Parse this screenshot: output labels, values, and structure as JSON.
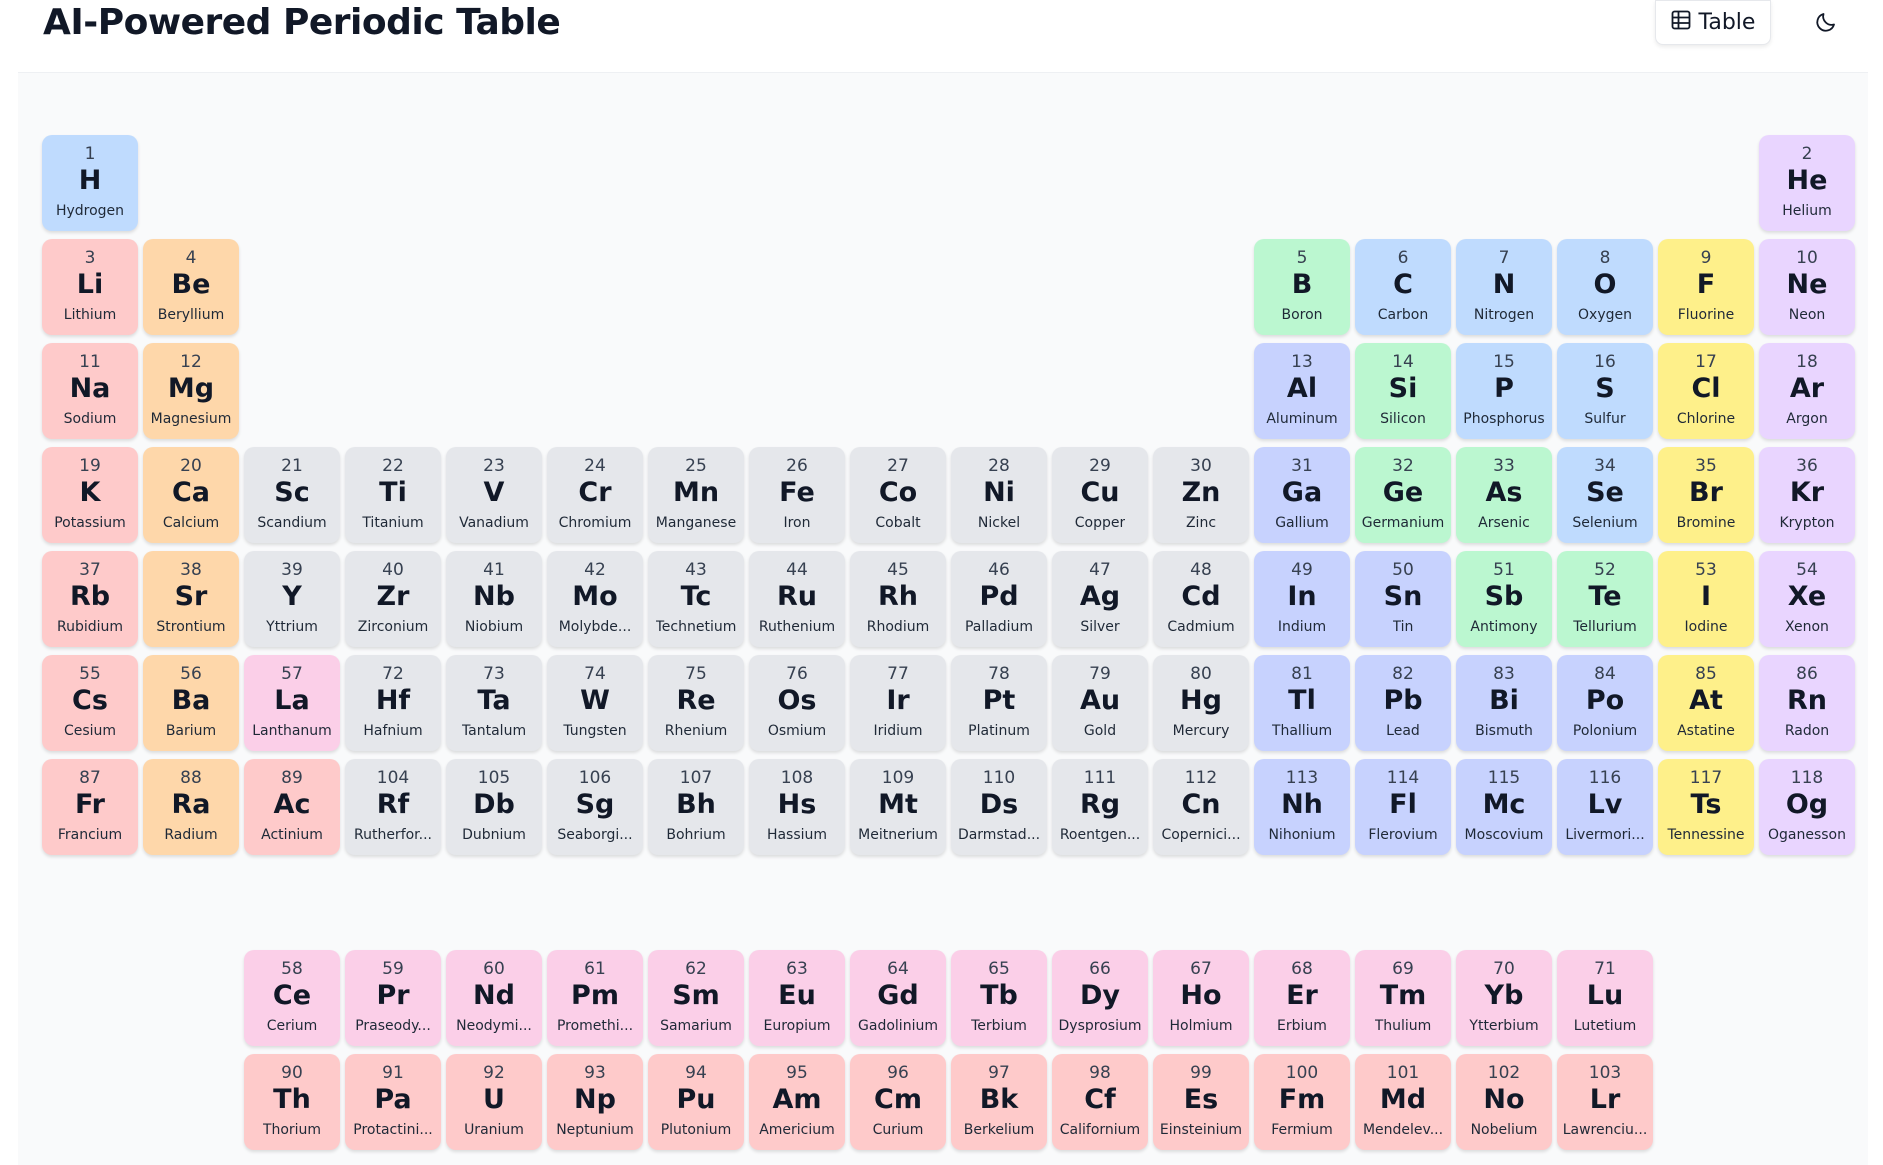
{
  "header": {
    "title": "AI-Powered Periodic Table",
    "view_button_label": "Table",
    "view_button_icon": "table-grid-icon",
    "theme_toggle_icon": "moon-icon"
  },
  "category_colors": {
    "alkali": "#fecaca",
    "alkaline": "#fed7aa",
    "transition": "#e5e7eb",
    "post_transition": "#c7d2fe",
    "metalloid": "#bbf7d0",
    "nonmetal": "#bfdbfe",
    "halogen": "#fef08a",
    "noble": "#e9d5ff",
    "lanthanide": "#fbcfe8",
    "actinide": "#fecaca"
  },
  "elements": [
    {
      "n": "1",
      "s": "H",
      "name": "Hydrogen",
      "cat": "nonmetal"
    },
    {
      "n": "2",
      "s": "He",
      "name": "Helium",
      "cat": "noble"
    },
    {
      "n": "3",
      "s": "Li",
      "name": "Lithium",
      "cat": "alkali"
    },
    {
      "n": "4",
      "s": "Be",
      "name": "Beryllium",
      "cat": "alkaline"
    },
    {
      "n": "5",
      "s": "B",
      "name": "Boron",
      "cat": "metalloid"
    },
    {
      "n": "6",
      "s": "C",
      "name": "Carbon",
      "cat": "nonmetal"
    },
    {
      "n": "7",
      "s": "N",
      "name": "Nitrogen",
      "cat": "nonmetal"
    },
    {
      "n": "8",
      "s": "O",
      "name": "Oxygen",
      "cat": "nonmetal"
    },
    {
      "n": "9",
      "s": "F",
      "name": "Fluorine",
      "cat": "halogen"
    },
    {
      "n": "10",
      "s": "Ne",
      "name": "Neon",
      "cat": "noble"
    },
    {
      "n": "11",
      "s": "Na",
      "name": "Sodium",
      "cat": "alkali"
    },
    {
      "n": "12",
      "s": "Mg",
      "name": "Magnesium",
      "cat": "alkaline"
    },
    {
      "n": "13",
      "s": "Al",
      "name": "Aluminum",
      "cat": "post_transition"
    },
    {
      "n": "14",
      "s": "Si",
      "name": "Silicon",
      "cat": "metalloid"
    },
    {
      "n": "15",
      "s": "P",
      "name": "Phosphorus",
      "cat": "nonmetal"
    },
    {
      "n": "16",
      "s": "S",
      "name": "Sulfur",
      "cat": "nonmetal"
    },
    {
      "n": "17",
      "s": "Cl",
      "name": "Chlorine",
      "cat": "halogen"
    },
    {
      "n": "18",
      "s": "Ar",
      "name": "Argon",
      "cat": "noble"
    },
    {
      "n": "19",
      "s": "K",
      "name": "Potassium",
      "cat": "alkali"
    },
    {
      "n": "20",
      "s": "Ca",
      "name": "Calcium",
      "cat": "alkaline"
    },
    {
      "n": "21",
      "s": "Sc",
      "name": "Scandium",
      "cat": "transition"
    },
    {
      "n": "22",
      "s": "Ti",
      "name": "Titanium",
      "cat": "transition"
    },
    {
      "n": "23",
      "s": "V",
      "name": "Vanadium",
      "cat": "transition"
    },
    {
      "n": "24",
      "s": "Cr",
      "name": "Chromium",
      "cat": "transition"
    },
    {
      "n": "25",
      "s": "Mn",
      "name": "Manganese",
      "cat": "transition"
    },
    {
      "n": "26",
      "s": "Fe",
      "name": "Iron",
      "cat": "transition"
    },
    {
      "n": "27",
      "s": "Co",
      "name": "Cobalt",
      "cat": "transition"
    },
    {
      "n": "28",
      "s": "Ni",
      "name": "Nickel",
      "cat": "transition"
    },
    {
      "n": "29",
      "s": "Cu",
      "name": "Copper",
      "cat": "transition"
    },
    {
      "n": "30",
      "s": "Zn",
      "name": "Zinc",
      "cat": "transition"
    },
    {
      "n": "31",
      "s": "Ga",
      "name": "Gallium",
      "cat": "post_transition"
    },
    {
      "n": "32",
      "s": "Ge",
      "name": "Germanium",
      "cat": "metalloid"
    },
    {
      "n": "33",
      "s": "As",
      "name": "Arsenic",
      "cat": "metalloid"
    },
    {
      "n": "34",
      "s": "Se",
      "name": "Selenium",
      "cat": "nonmetal"
    },
    {
      "n": "35",
      "s": "Br",
      "name": "Bromine",
      "cat": "halogen"
    },
    {
      "n": "36",
      "s": "Kr",
      "name": "Krypton",
      "cat": "noble"
    },
    {
      "n": "37",
      "s": "Rb",
      "name": "Rubidium",
      "cat": "alkali"
    },
    {
      "n": "38",
      "s": "Sr",
      "name": "Strontium",
      "cat": "alkaline"
    },
    {
      "n": "39",
      "s": "Y",
      "name": "Yttrium",
      "cat": "transition"
    },
    {
      "n": "40",
      "s": "Zr",
      "name": "Zirconium",
      "cat": "transition"
    },
    {
      "n": "41",
      "s": "Nb",
      "name": "Niobium",
      "cat": "transition"
    },
    {
      "n": "42",
      "s": "Mo",
      "name": "Molybde...",
      "cat": "transition"
    },
    {
      "n": "43",
      "s": "Tc",
      "name": "Technetium",
      "cat": "transition"
    },
    {
      "n": "44",
      "s": "Ru",
      "name": "Ruthenium",
      "cat": "transition"
    },
    {
      "n": "45",
      "s": "Rh",
      "name": "Rhodium",
      "cat": "transition"
    },
    {
      "n": "46",
      "s": "Pd",
      "name": "Palladium",
      "cat": "transition"
    },
    {
      "n": "47",
      "s": "Ag",
      "name": "Silver",
      "cat": "transition"
    },
    {
      "n": "48",
      "s": "Cd",
      "name": "Cadmium",
      "cat": "transition"
    },
    {
      "n": "49",
      "s": "In",
      "name": "Indium",
      "cat": "post_transition"
    },
    {
      "n": "50",
      "s": "Sn",
      "name": "Tin",
      "cat": "post_transition"
    },
    {
      "n": "51",
      "s": "Sb",
      "name": "Antimony",
      "cat": "metalloid"
    },
    {
      "n": "52",
      "s": "Te",
      "name": "Tellurium",
      "cat": "metalloid"
    },
    {
      "n": "53",
      "s": "I",
      "name": "Iodine",
      "cat": "halogen"
    },
    {
      "n": "54",
      "s": "Xe",
      "name": "Xenon",
      "cat": "noble"
    },
    {
      "n": "55",
      "s": "Cs",
      "name": "Cesium",
      "cat": "alkali"
    },
    {
      "n": "56",
      "s": "Ba",
      "name": "Barium",
      "cat": "alkaline"
    },
    {
      "n": "57",
      "s": "La",
      "name": "Lanthanum",
      "cat": "lanthanide"
    },
    {
      "n": "72",
      "s": "Hf",
      "name": "Hafnium",
      "cat": "transition"
    },
    {
      "n": "73",
      "s": "Ta",
      "name": "Tantalum",
      "cat": "transition"
    },
    {
      "n": "74",
      "s": "W",
      "name": "Tungsten",
      "cat": "transition"
    },
    {
      "n": "75",
      "s": "Re",
      "name": "Rhenium",
      "cat": "transition"
    },
    {
      "n": "76",
      "s": "Os",
      "name": "Osmium",
      "cat": "transition"
    },
    {
      "n": "77",
      "s": "Ir",
      "name": "Iridium",
      "cat": "transition"
    },
    {
      "n": "78",
      "s": "Pt",
      "name": "Platinum",
      "cat": "transition"
    },
    {
      "n": "79",
      "s": "Au",
      "name": "Gold",
      "cat": "transition"
    },
    {
      "n": "80",
      "s": "Hg",
      "name": "Mercury",
      "cat": "transition"
    },
    {
      "n": "81",
      "s": "Tl",
      "name": "Thallium",
      "cat": "post_transition"
    },
    {
      "n": "82",
      "s": "Pb",
      "name": "Lead",
      "cat": "post_transition"
    },
    {
      "n": "83",
      "s": "Bi",
      "name": "Bismuth",
      "cat": "post_transition"
    },
    {
      "n": "84",
      "s": "Po",
      "name": "Polonium",
      "cat": "post_transition"
    },
    {
      "n": "85",
      "s": "At",
      "name": "Astatine",
      "cat": "halogen"
    },
    {
      "n": "86",
      "s": "Rn",
      "name": "Radon",
      "cat": "noble"
    },
    {
      "n": "87",
      "s": "Fr",
      "name": "Francium",
      "cat": "alkali"
    },
    {
      "n": "88",
      "s": "Ra",
      "name": "Radium",
      "cat": "alkaline"
    },
    {
      "n": "89",
      "s": "Ac",
      "name": "Actinium",
      "cat": "actinide"
    },
    {
      "n": "104",
      "s": "Rf",
      "name": "Rutherfor...",
      "cat": "transition"
    },
    {
      "n": "105",
      "s": "Db",
      "name": "Dubnium",
      "cat": "transition"
    },
    {
      "n": "106",
      "s": "Sg",
      "name": "Seaborgi...",
      "cat": "transition"
    },
    {
      "n": "107",
      "s": "Bh",
      "name": "Bohrium",
      "cat": "transition"
    },
    {
      "n": "108",
      "s": "Hs",
      "name": "Hassium",
      "cat": "transition"
    },
    {
      "n": "109",
      "s": "Mt",
      "name": "Meitnerium",
      "cat": "transition"
    },
    {
      "n": "110",
      "s": "Ds",
      "name": "Darmstad...",
      "cat": "transition"
    },
    {
      "n": "111",
      "s": "Rg",
      "name": "Roentgen...",
      "cat": "transition"
    },
    {
      "n": "112",
      "s": "Cn",
      "name": "Copernici...",
      "cat": "transition"
    },
    {
      "n": "113",
      "s": "Nh",
      "name": "Nihonium",
      "cat": "post_transition"
    },
    {
      "n": "114",
      "s": "Fl",
      "name": "Flerovium",
      "cat": "post_transition"
    },
    {
      "n": "115",
      "s": "Mc",
      "name": "Moscovium",
      "cat": "post_transition"
    },
    {
      "n": "116",
      "s": "Lv",
      "name": "Livermori...",
      "cat": "post_transition"
    },
    {
      "n": "117",
      "s": "Ts",
      "name": "Tennessine",
      "cat": "halogen"
    },
    {
      "n": "118",
      "s": "Og",
      "name": "Oganesson",
      "cat": "noble"
    },
    {
      "n": "58",
      "s": "Ce",
      "name": "Cerium",
      "cat": "lanthanide"
    },
    {
      "n": "59",
      "s": "Pr",
      "name": "Praseody...",
      "cat": "lanthanide"
    },
    {
      "n": "60",
      "s": "Nd",
      "name": "Neodymi...",
      "cat": "lanthanide"
    },
    {
      "n": "61",
      "s": "Pm",
      "name": "Promethi...",
      "cat": "lanthanide"
    },
    {
      "n": "62",
      "s": "Sm",
      "name": "Samarium",
      "cat": "lanthanide"
    },
    {
      "n": "63",
      "s": "Eu",
      "name": "Europium",
      "cat": "lanthanide"
    },
    {
      "n": "64",
      "s": "Gd",
      "name": "Gadolinium",
      "cat": "lanthanide"
    },
    {
      "n": "65",
      "s": "Tb",
      "name": "Terbium",
      "cat": "lanthanide"
    },
    {
      "n": "66",
      "s": "Dy",
      "name": "Dysprosium",
      "cat": "lanthanide"
    },
    {
      "n": "67",
      "s": "Ho",
      "name": "Holmium",
      "cat": "lanthanide"
    },
    {
      "n": "68",
      "s": "Er",
      "name": "Erbium",
      "cat": "lanthanide"
    },
    {
      "n": "69",
      "s": "Tm",
      "name": "Thulium",
      "cat": "lanthanide"
    },
    {
      "n": "70",
      "s": "Yb",
      "name": "Ytterbium",
      "cat": "lanthanide"
    },
    {
      "n": "71",
      "s": "Lu",
      "name": "Lutetium",
      "cat": "lanthanide"
    },
    {
      "n": "90",
      "s": "Th",
      "name": "Thorium",
      "cat": "actinide"
    },
    {
      "n": "91",
      "s": "Pa",
      "name": "Protactini...",
      "cat": "actinide"
    },
    {
      "n": "92",
      "s": "U",
      "name": "Uranium",
      "cat": "actinide"
    },
    {
      "n": "93",
      "s": "Np",
      "name": "Neptunium",
      "cat": "actinide"
    },
    {
      "n": "94",
      "s": "Pu",
      "name": "Plutonium",
      "cat": "actinide"
    },
    {
      "n": "95",
      "s": "Am",
      "name": "Americium",
      "cat": "actinide"
    },
    {
      "n": "96",
      "s": "Cm",
      "name": "Curium",
      "cat": "actinide"
    },
    {
      "n": "97",
      "s": "Bk",
      "name": "Berkelium",
      "cat": "actinide"
    },
    {
      "n": "98",
      "s": "Cf",
      "name": "Californium",
      "cat": "actinide"
    },
    {
      "n": "99",
      "s": "Es",
      "name": "Einsteinium",
      "cat": "actinide"
    },
    {
      "n": "100",
      "s": "Fm",
      "name": "Fermium",
      "cat": "actinide"
    },
    {
      "n": "101",
      "s": "Md",
      "name": "Mendelev...",
      "cat": "actinide"
    },
    {
      "n": "102",
      "s": "No",
      "name": "Nobelium",
      "cat": "actinide"
    },
    {
      "n": "103",
      "s": "Lr",
      "name": "Lawrenciu...",
      "cat": "actinide"
    }
  ]
}
